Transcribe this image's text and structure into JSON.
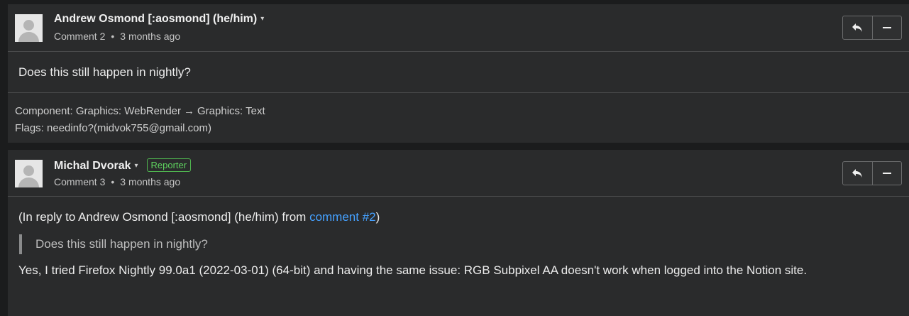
{
  "comments": [
    {
      "author": "Andrew Osmond [:aosmond] (he/him)",
      "caret": "▾",
      "comment_number": "Comment 2",
      "separator": "•",
      "time": "3 months ago",
      "body": "Does this still happen in nightly?",
      "activity": {
        "component_label": "Component: Graphics: WebRender",
        "arrow": "→",
        "component_new": "Graphics: Text",
        "flags": "Flags: needinfo?(midvok755@gmail.com)"
      }
    },
    {
      "author": "Michal Dvorak",
      "caret": "▾",
      "badge": "Reporter",
      "comment_number": "Comment 3",
      "separator": "•",
      "time": "3 months ago",
      "reply_prefix": "(In reply to Andrew Osmond [:aosmond] (he/him) from ",
      "reply_link": "comment #2",
      "reply_suffix": ")",
      "quote": "Does this still happen in nightly?",
      "body": "Yes, I tried Firefox Nightly 99.0a1 (2022-03-01) (64-bit) and having the same issue: RGB Subpixel AA doesn't work when logged into the Notion site."
    }
  ],
  "icons": {
    "reply": "reply-icon",
    "collapse": "collapse-icon",
    "avatar": "avatar-icon"
  },
  "colors": {
    "page_bg": "#1b1c1d",
    "card_bg": "#2a2b2c",
    "link": "#45a1ff",
    "reporter_badge": "#5fd35f"
  }
}
